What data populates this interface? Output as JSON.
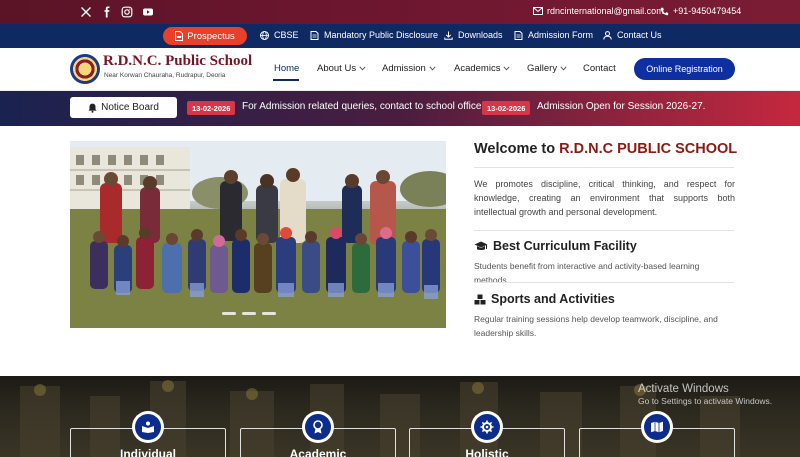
{
  "topbar": {
    "email": "rdncinternational@gmail.com",
    "phone": "+91-9450479454",
    "social_icons": [
      "x-icon",
      "facebook-icon",
      "instagram-icon",
      "youtube-icon"
    ]
  },
  "subnav": {
    "prospectus": "Prospectus",
    "cbse": "CBSE",
    "disclosure": "Mandatory Public Disclosure",
    "downloads": "Downloads",
    "admission_form": "Admission Form",
    "contact": "Contact Us"
  },
  "brand": {
    "name": "R.D.N.C. Public School",
    "address": "Near Korwan Chauraha, Rudrapur, Deoria"
  },
  "nav": {
    "home": "Home",
    "about": "About Us",
    "admission": "Admission",
    "academics": "Academics",
    "gallery": "Gallery",
    "contact": "Contact",
    "register": "Online Registration"
  },
  "notice": {
    "button": "Notice Board",
    "items": [
      {
        "date": "13-02-2026",
        "text": "For Admission related queries, contact to school office."
      },
      {
        "date": "13-02-2026",
        "text": "Admission Open for Session 2026-27."
      }
    ]
  },
  "welcome": {
    "title_prefix": "Welcome to",
    "title_highlight": "R.D.N.C PUBLIC SCHOOL",
    "description": "We promotes discipline, critical thinking, and respect for knowledge, creating an environment that supports both intellectual growth and personal development."
  },
  "features": [
    {
      "title": "Best Curriculum Facility",
      "desc": "Students benefit from interactive and activity-based learning methods.",
      "icon": "graduation-cap-icon"
    },
    {
      "title": "Sports and Activities",
      "desc": "Regular training sessions help develop teamwork, discipline, and leadership skills.",
      "icon": "cubes-icon"
    }
  ],
  "cards": [
    {
      "title": "Individual",
      "icon": "book-reader-icon"
    },
    {
      "title": "Academic",
      "icon": "award-icon"
    },
    {
      "title": "Holistic",
      "icon": "gear-icon"
    },
    {
      "title": "",
      "icon": "map-icon"
    }
  ],
  "watermark": {
    "line1": "Activate Windows",
    "line2": "Go to Settings to activate Windows."
  },
  "colors": {
    "brand_maroon": "#7a1324",
    "nav_blue": "#0f2a63",
    "button_blue": "#0d2fa0",
    "prospectus_red": "#e8402a",
    "date_tag_red": "#d83548"
  }
}
